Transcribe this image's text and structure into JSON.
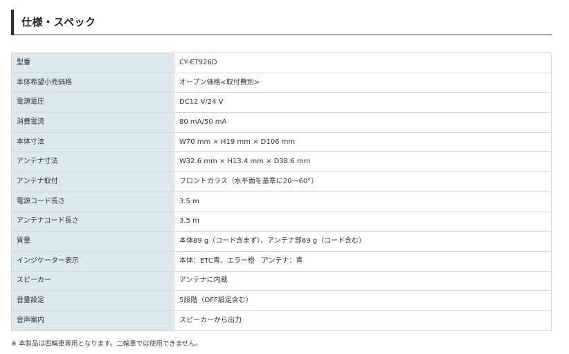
{
  "section": {
    "title": "仕様・スペック"
  },
  "specs": [
    {
      "label": "型番",
      "value": "CY-ET926D"
    },
    {
      "label": "本体希望小売価格",
      "value": "オープン価格<取付費別>"
    },
    {
      "label": "電源電圧",
      "value": "DC12 V/24 V"
    },
    {
      "label": "消費電流",
      "value": "80 mA/50 mA"
    },
    {
      "label": "本体寸法",
      "value": "W70 mm × H19 mm × D106 mm"
    },
    {
      "label": "アンテナ寸法",
      "value": "W32.6 mm × H13.4 mm × D38.6 mm"
    },
    {
      "label": "アンテナ取付",
      "value": "フロントガラス（水平面を基準に20～60°）"
    },
    {
      "label": "電源コード長さ",
      "value": "3.5 m"
    },
    {
      "label": "アンテナコード長さ",
      "value": "3.5 m"
    },
    {
      "label": "質量",
      "value": "本体89 g（コード含まず）、アンテナ部69 g（コード含む）"
    },
    {
      "label": "インジケーター表示",
      "value": "本体：ETC青、エラー橙　アンテナ：青"
    },
    {
      "label": "スピーカー",
      "value": "アンテナに内蔵"
    },
    {
      "label": "音量設定",
      "value": "5段階（OFF設定含む）"
    },
    {
      "label": "音声案内",
      "value": "スピーカーから出力"
    }
  ],
  "footnote": "※ 本製品は四輪車専用となります。二輪車では使用できません。",
  "colors": {
    "label_background": "#dbe9ef",
    "border": "#d7d7d7",
    "header_accent": "#333333"
  }
}
